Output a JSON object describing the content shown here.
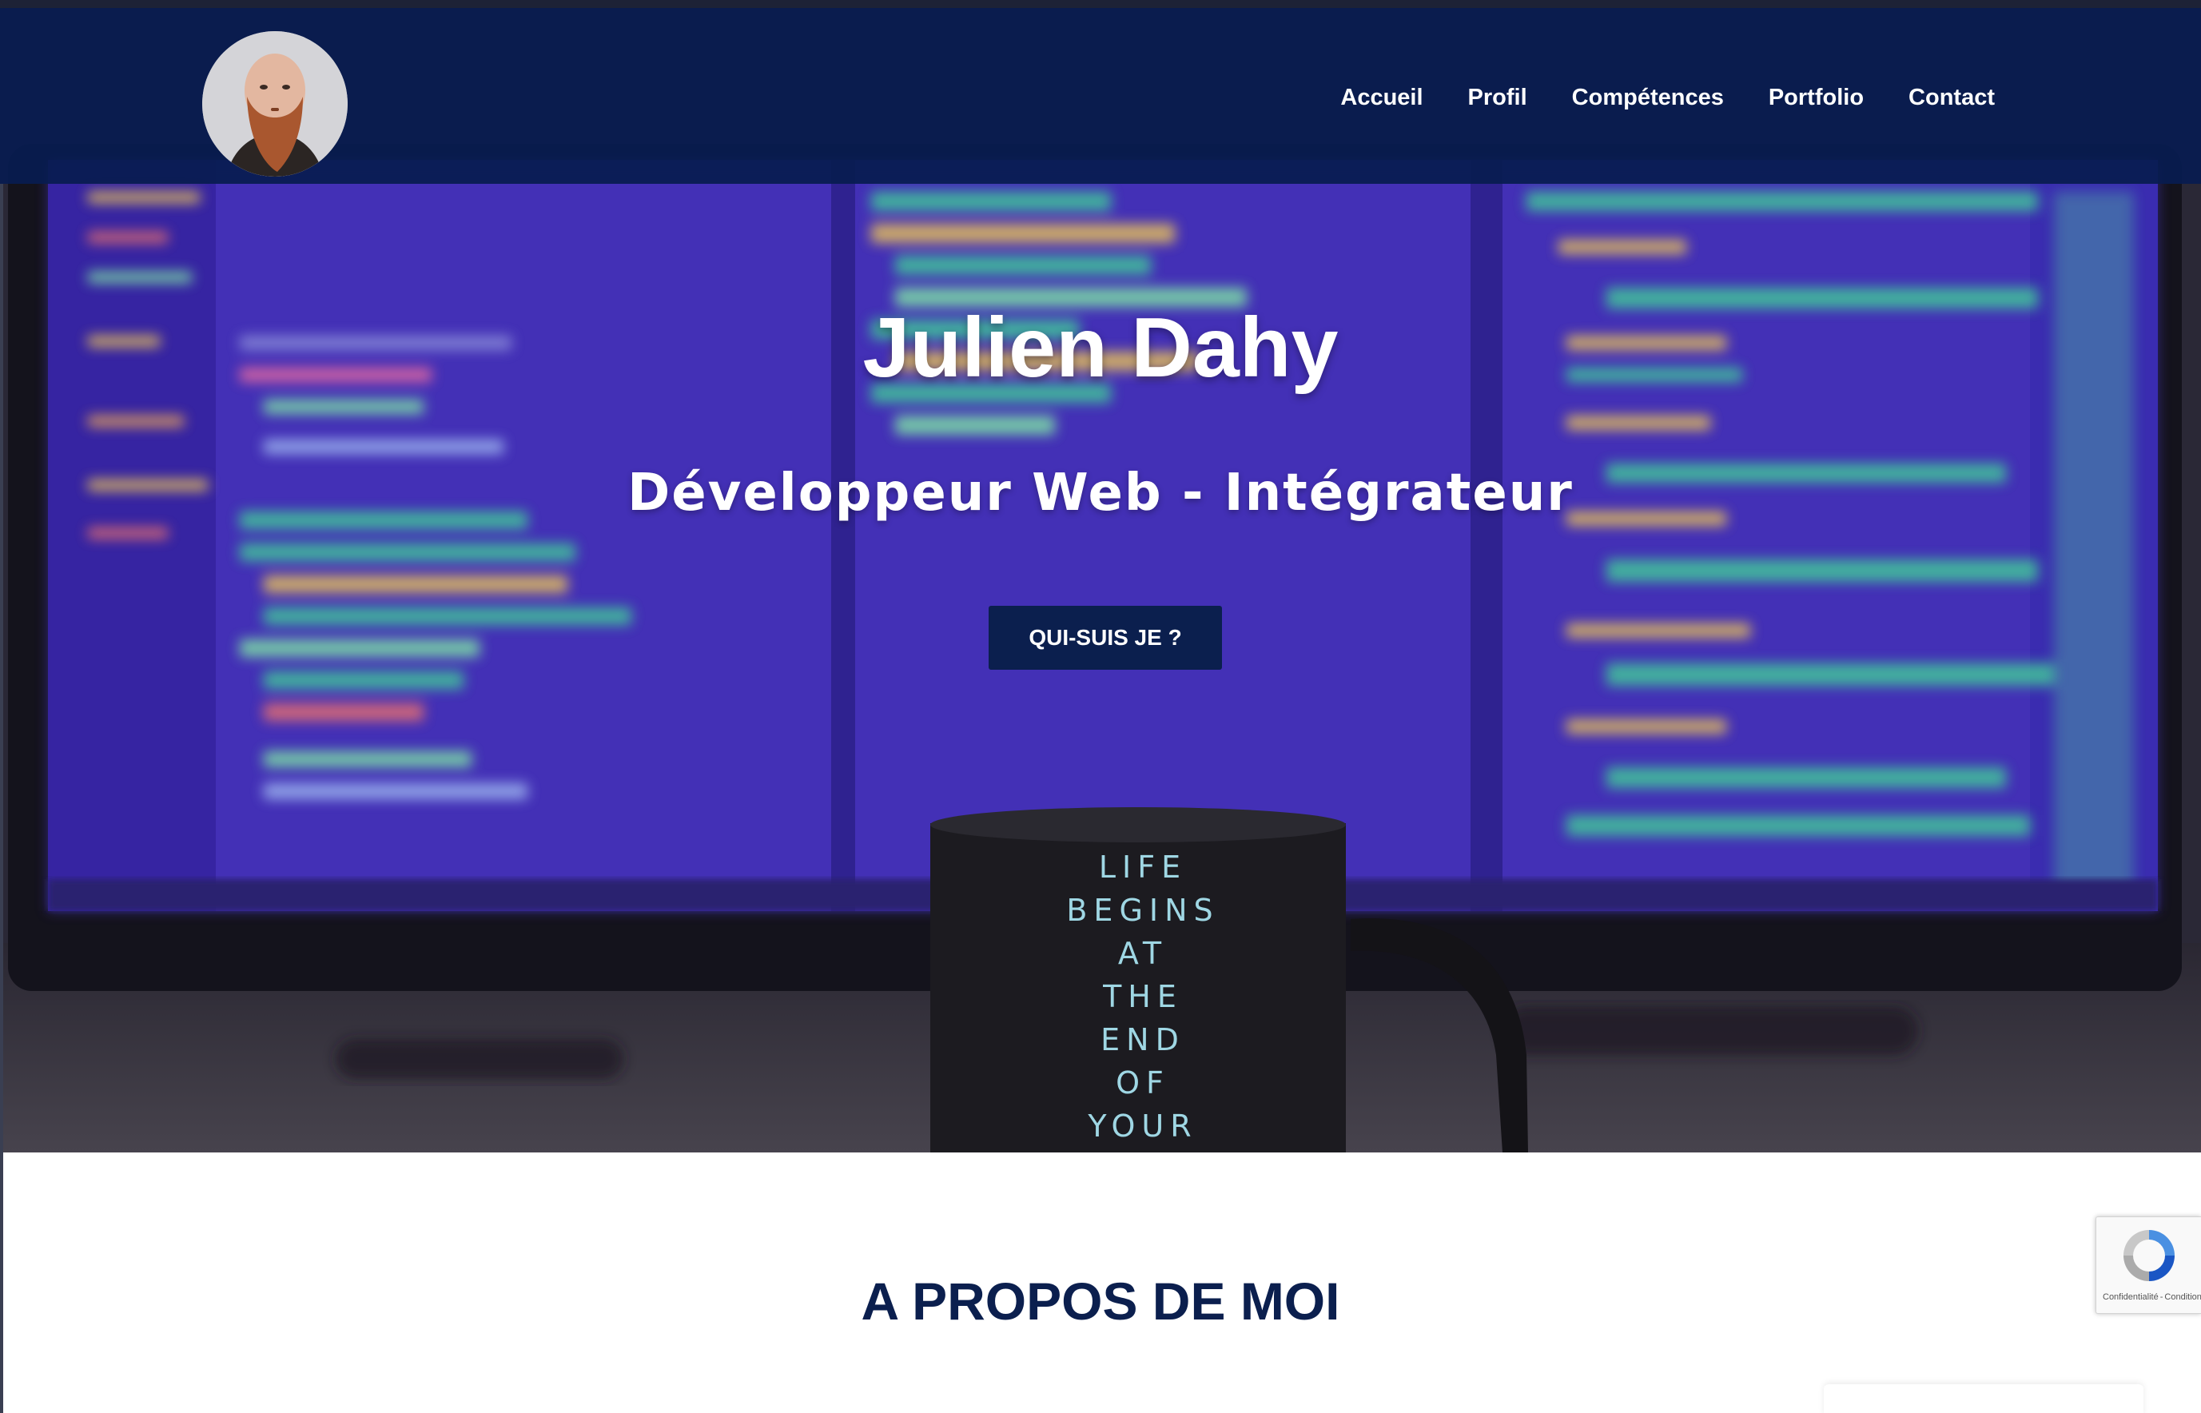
{
  "nav": {
    "items": [
      {
        "label": "Accueil"
      },
      {
        "label": "Profil"
      },
      {
        "label": "Compétences"
      },
      {
        "label": "Portfolio"
      },
      {
        "label": "Contact"
      }
    ]
  },
  "hero": {
    "title": "Julien Dahy",
    "subtitle": "Développeur Web - Intégrateur",
    "button_label": "QUI-SUIS JE ?",
    "mug_lines": [
      "LIFE",
      "BEGINS",
      "AT",
      "THE",
      "END",
      "OF",
      "YOUR"
    ]
  },
  "about": {
    "title": "A PROPOS DE MOI"
  },
  "recaptcha": {
    "privacy": "Confidentialité",
    "separator": "-",
    "terms": "Conditions"
  },
  "colors": {
    "navbar": "#0b1f4e",
    "accent": "#0b1f4e",
    "hero_overlay": "#3b2d8c"
  }
}
